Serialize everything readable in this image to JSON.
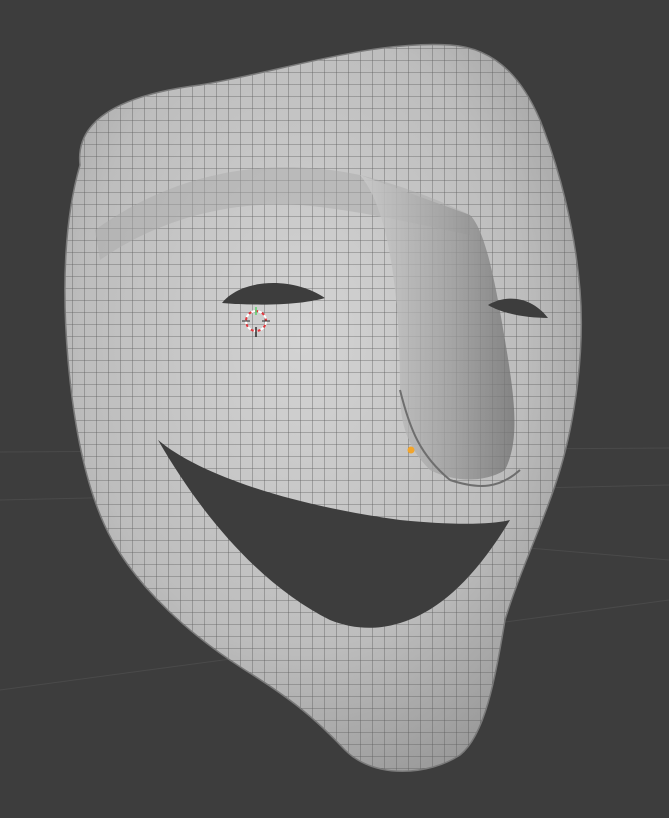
{
  "viewport": {
    "background_color": "#3d3d3d",
    "grid_line_color": "#4a4a4a",
    "mesh_surface_color": "#bdbdbd",
    "mesh_shadow_color": "#8f8f8f",
    "wireframe_color": "#5b5b5b",
    "selected_vertex_color": "#f2a52c",
    "cursor_ring_colors": [
      "#ffffff",
      "#e0383e"
    ],
    "gizmo_axis_colors": [
      "#5bd16b",
      "#2b2b2b"
    ]
  },
  "icons": {
    "cursor": "3d-cursor-icon",
    "vertex": "selected-vertex-icon"
  }
}
